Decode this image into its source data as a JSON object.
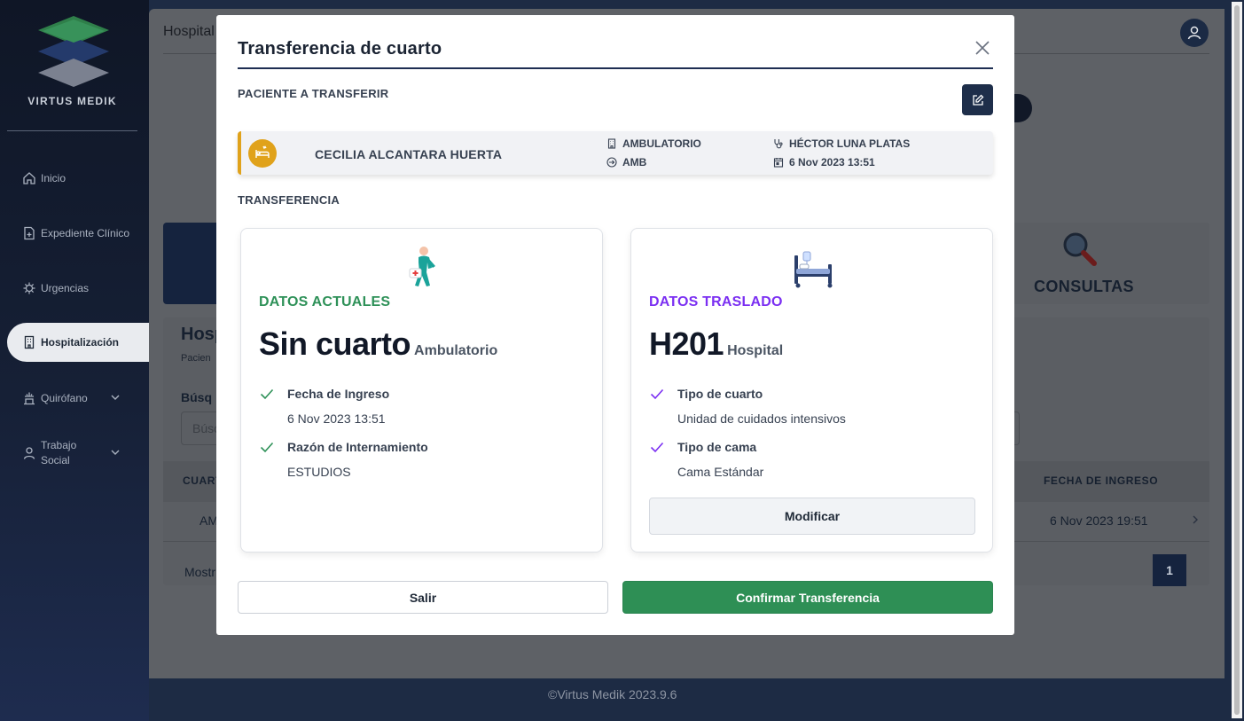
{
  "app": {
    "brand": "VIRTUS MEDIK",
    "footer": "©Virtus Medik 2023.9.6"
  },
  "sidebar": {
    "items": [
      {
        "label": "Inicio",
        "icon": "home-icon"
      },
      {
        "label": "Expediente Clínico",
        "icon": "file-plus-icon"
      },
      {
        "label": "Urgencias",
        "icon": "virus-icon"
      },
      {
        "label": "Hospitalización",
        "icon": "hospital-building-icon",
        "active": true
      },
      {
        "label": "Quirófano",
        "icon": "surgery-lamp-icon",
        "expandable": true
      },
      {
        "label": "Trabajo Social",
        "icon": "person-icon",
        "expandable": true
      }
    ]
  },
  "background": {
    "header_title": "Hospital",
    "card_label": "CONSULTAS",
    "panel_title": "Hosp",
    "panel_subtitle": "Pacien",
    "search_label": "Búsq",
    "search_placeholder": "Búsc",
    "table_headers": {
      "first": "CUART",
      "last": "FECHA DE INGRESO"
    },
    "row": {
      "room": "AM",
      "date": "6 Nov 2023 19:51"
    },
    "showing_text": "Mostr",
    "page": "1"
  },
  "modal": {
    "title": "Transferencia de cuarto",
    "patient_section": "PACIENTE A TRANSFERIR",
    "transfer_section": "TRANSFERENCIA",
    "patient": {
      "name": "CECILIA ALCANTARA HUERTA",
      "area": "AMBULATORIO",
      "area_code": "AMB",
      "doctor": "HÉCTOR LUNA PLATAS",
      "date": "6 Nov 2023 13:51",
      "accent_color": "#e0a21b"
    },
    "current": {
      "heading": "DATOS ACTUALES",
      "heading_color": "#2e9158",
      "room": "Sin cuarto",
      "area": "Ambulatorio",
      "fields": [
        {
          "label": "Fecha de Ingreso",
          "value": "6 Nov 2023 13:51"
        },
        {
          "label": "Razón de Internamiento",
          "value": "ESTUDIOS"
        }
      ]
    },
    "target": {
      "heading": "DATOS TRASLADO",
      "heading_color": "#7b2ff2",
      "room": "H201",
      "area": "Hospital",
      "fields": [
        {
          "label": "Tipo de cuarto",
          "value": "Unidad de cuidados intensivos"
        },
        {
          "label": "Tipo de cama",
          "value": "Cama Estándar"
        }
      ],
      "modify_label": "Modificar"
    },
    "exit_label": "Salir",
    "confirm_label": "Confirmar Transferencia",
    "confirm_color": "#2e8f55"
  }
}
